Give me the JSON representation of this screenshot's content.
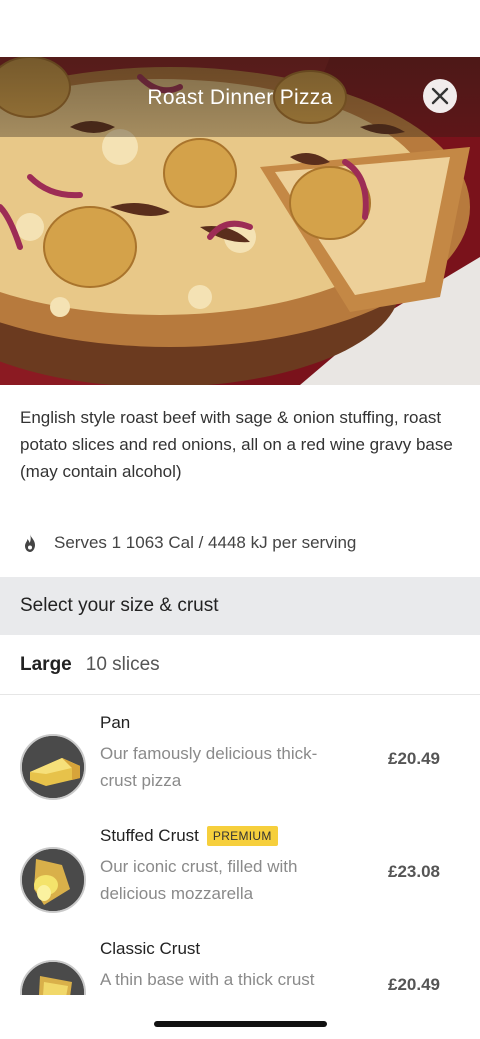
{
  "modal": {
    "title": "Roast Dinner Pizza",
    "close_icon": "close-icon",
    "description": "English style roast beef with sage & onion stuffing, roast potato slices and red onions, all on a red wine gravy base (may contain alcohol)",
    "nutrition_icon": "flame-icon",
    "nutrition": "Serves 1 1063 Cal / 4448 kJ per serving",
    "section_header": "Select your size & crust",
    "size": {
      "name": "Large",
      "slices": "10 slices"
    },
    "crusts": [
      {
        "name": "Pan",
        "badge": "",
        "description": "Our famously delicious thick-crust pizza",
        "price": "£20.49"
      },
      {
        "name": "Stuffed Crust",
        "badge": "PREMIUM",
        "description": "Our iconic crust, filled with delicious mozzarella",
        "price": "£23.08"
      },
      {
        "name": "Classic Crust",
        "badge": "",
        "description": "A thin base with a thick crust",
        "price": "£20.49"
      }
    ]
  },
  "colors": {
    "badge": "#f6cf3c",
    "section_bg": "#e9eaec",
    "muted_text": "#8a8a8a",
    "price_text": "#555555"
  }
}
